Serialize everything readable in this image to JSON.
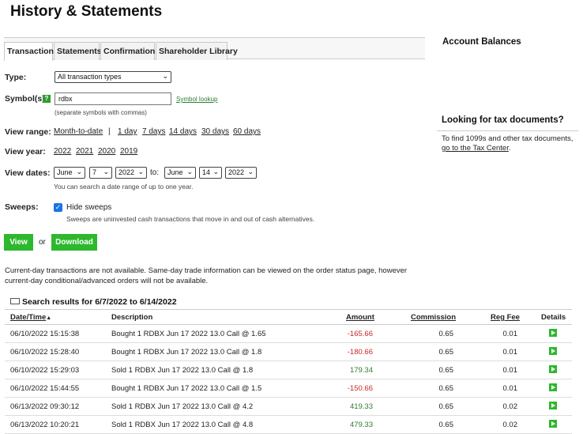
{
  "page": {
    "title": "History & Statements"
  },
  "tabs": [
    "Transactions",
    "Statements",
    "Confirmations",
    "Shareholder Library"
  ],
  "form": {
    "type_label": "Type:",
    "type_value": "All transaction types",
    "symbols_label": "Symbol(s):",
    "help_glyph": "?",
    "symbols_value": "rdbx",
    "symbol_lookup": "Symbol lookup",
    "symbols_note": "(separate symbols with commas)",
    "view_range_label": "View range:",
    "view_range": [
      "Month-to-date",
      "1 day",
      "7 days",
      "14 days",
      "30 days",
      "60 days"
    ],
    "view_range_sep": "|",
    "view_year_label": "View year:",
    "view_year": [
      "2022",
      "2021",
      "2020",
      "2019"
    ],
    "view_dates_label": "View dates:",
    "from_month": "June",
    "from_day": "7",
    "from_year": "2022",
    "to_label": "to:",
    "to_month": "June",
    "to_day": "14",
    "to_year": "2022",
    "dates_note": "You can search a date range of up to one year.",
    "sweeps_label": "Sweeps:",
    "hide_sweeps": "Hide sweeps",
    "hide_sweeps_checked": true,
    "sweeps_note": "Sweeps are uninvested cash transactions that move in and out of cash alternatives.",
    "view_button": "View",
    "or_text": "or",
    "download_button": "Download"
  },
  "info_text": "Current-day transactions are not available. Same-day trade information can be viewed on the order status page, however current-day conditional/advanced orders will not be available.",
  "results": {
    "heading": "Search results for 6/7/2022 to 6/14/2022",
    "columns": [
      "Date/Time",
      "Description",
      "Amount",
      "Commission",
      "Reg Fee",
      "Details"
    ],
    "sort_indicator": "▲",
    "rows": [
      {
        "datetime": "06/10/2022 15:15:38",
        "description": "Bought 1 RDBX Jun 17 2022 13.0 Call @ 1.65",
        "amount": "-165.66",
        "commission": "0.65",
        "reg_fee": "0.01"
      },
      {
        "datetime": "06/10/2022 15:28:40",
        "description": "Bought 1 RDBX Jun 17 2022 13.0 Call @ 1.8",
        "amount": "-180.66",
        "commission": "0.65",
        "reg_fee": "0.01"
      },
      {
        "datetime": "06/10/2022 15:29:03",
        "description": "Sold 1 RDBX Jun 17 2022 13.0 Call @ 1.8",
        "amount": "179.34",
        "commission": "0.65",
        "reg_fee": "0.01"
      },
      {
        "datetime": "06/10/2022 15:44:55",
        "description": "Bought 1 RDBX Jun 17 2022 13.0 Call @ 1.5",
        "amount": "-150.66",
        "commission": "0.65",
        "reg_fee": "0.01"
      },
      {
        "datetime": "06/13/2022 09:30:12",
        "description": "Sold 1 RDBX Jun 17 2022 13.0 Call @ 4.2",
        "amount": "419.33",
        "commission": "0.65",
        "reg_fee": "0.02"
      },
      {
        "datetime": "06/13/2022 10:20:21",
        "description": "Sold 1 RDBX Jun 17 2022 13.0 Call @ 4.8",
        "amount": "479.33",
        "commission": "0.65",
        "reg_fee": "0.02"
      }
    ]
  },
  "sidebar": {
    "balances_title": "Account Balances",
    "tax_title": "Looking for tax documents?",
    "tax_text": "To find 1099s and other tax documents,",
    "tax_link": "go to the Tax Center",
    "tax_end": "."
  },
  "colors": {
    "accent_green": "#2db82d",
    "negative": "#c62828",
    "positive": "#2e7d32"
  },
  "icons": {
    "help": "help-icon",
    "envelope": "envelope-icon",
    "details": "play-icon",
    "dropdown": "chevron-down-icon"
  }
}
